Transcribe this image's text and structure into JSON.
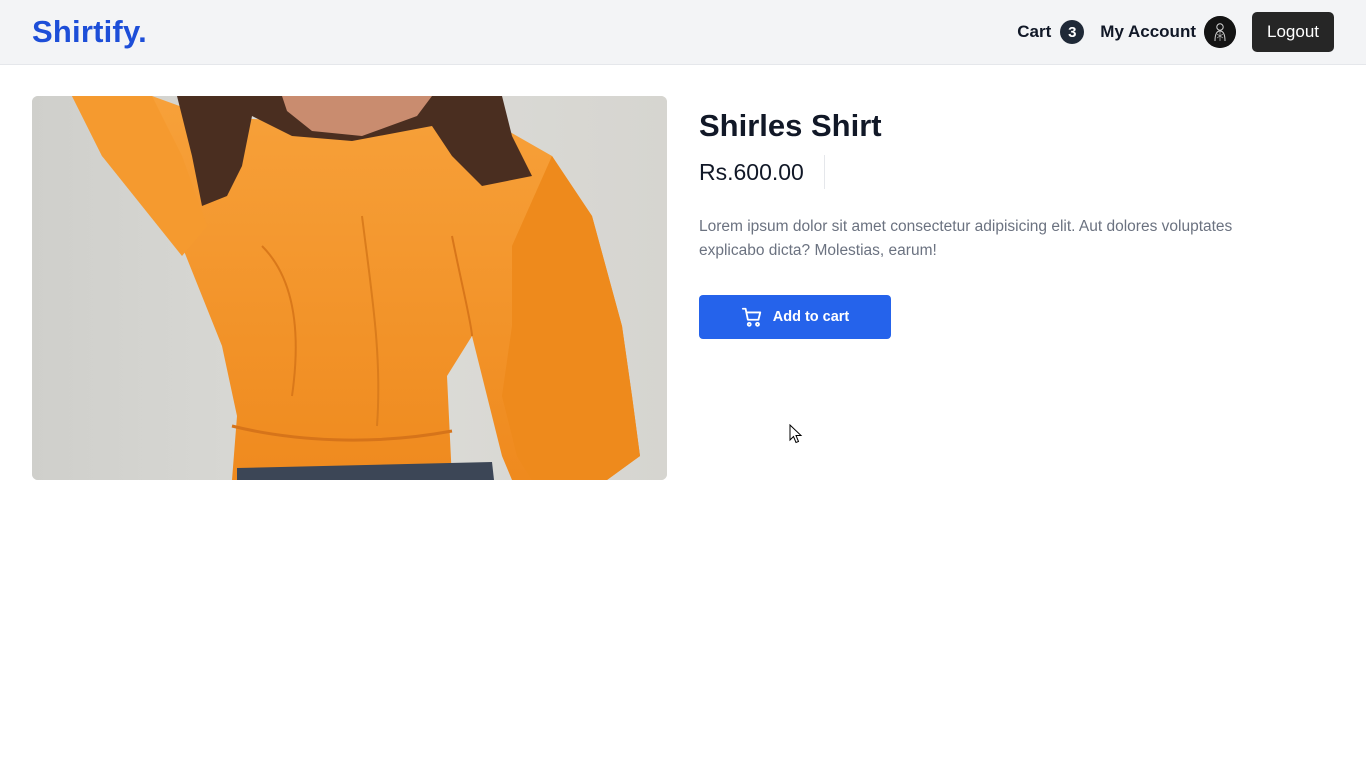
{
  "header": {
    "brand": "Shirtify.",
    "cart_label": "Cart",
    "cart_count": "3",
    "account_label": "My Account",
    "logout_label": "Logout"
  },
  "product": {
    "title": "Shirles Shirt",
    "price": "Rs.600.00",
    "description": "Lorem ipsum dolor sit amet consectetur adipisicing elit. Aut dolores voluptates explicabo dicta? Molestias, earum!",
    "add_to_cart_label": "Add to cart",
    "image_subject": "person-in-orange-sweatshirt"
  },
  "icons": {
    "add_to_cart": "shopping-cart-icon",
    "avatar": "avatar-image",
    "pointer": "mouse-cursor-icon"
  },
  "colors": {
    "brand": "#1d4ed8",
    "primary_button": "#2563eb",
    "logout_button": "#262626",
    "header_bg": "#f3f4f6",
    "badge_bg": "#1f2937",
    "description_text": "#6b7280",
    "sweatshirt": "#f39226"
  }
}
